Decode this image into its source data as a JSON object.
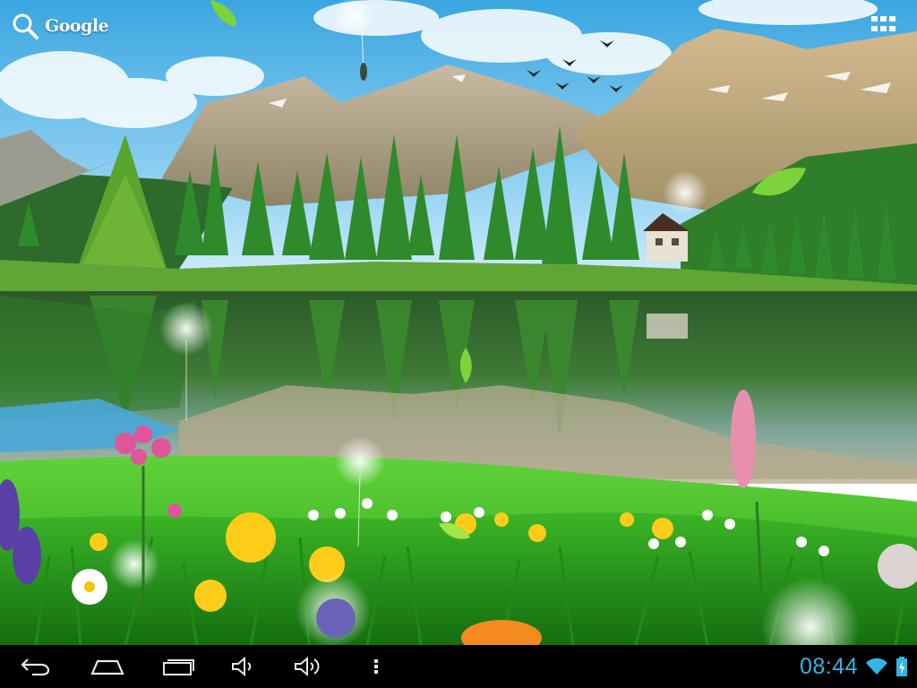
{
  "search_widget": {
    "label": "Google",
    "icon": "search-icon"
  },
  "launcher": {
    "all_apps_icon": "grid-icon"
  },
  "navigation_bar": {
    "buttons": [
      {
        "icon": "back-icon"
      },
      {
        "icon": "home-icon"
      },
      {
        "icon": "recent-apps-icon"
      },
      {
        "icon": "volume-down-icon"
      },
      {
        "icon": "volume-up-icon"
      },
      {
        "icon": "menu-icon"
      }
    ]
  },
  "status": {
    "time": "08:44",
    "wifi_icon": "wifi-icon",
    "battery_icon": "battery-charging-icon",
    "accent_color": "#33b5e5"
  }
}
